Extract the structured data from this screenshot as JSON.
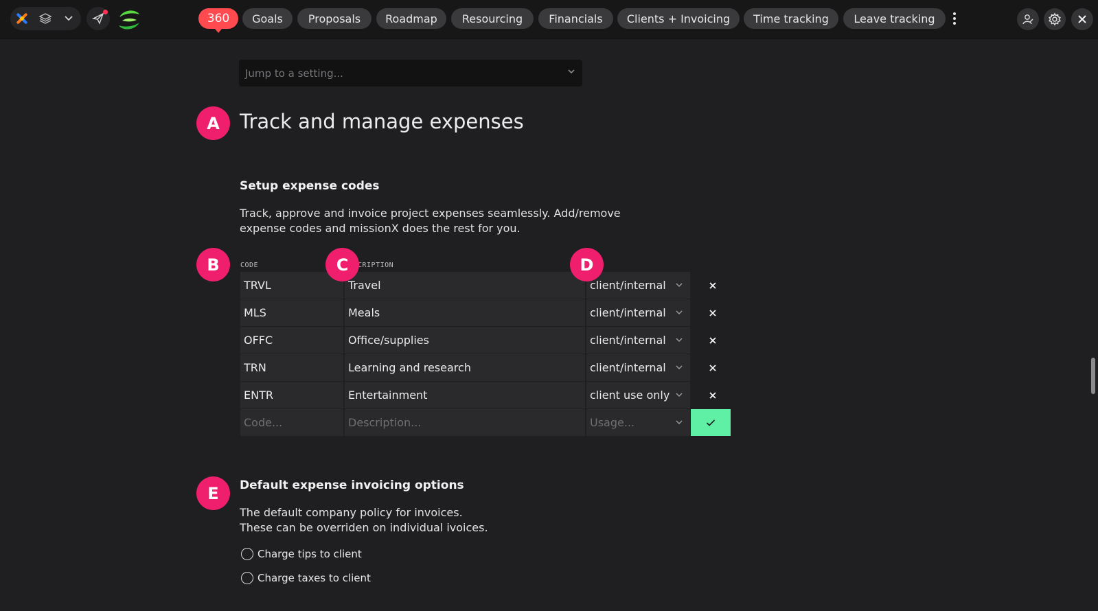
{
  "nav": {
    "tabs": [
      {
        "label": "360"
      },
      {
        "label": "Goals"
      },
      {
        "label": "Proposals"
      },
      {
        "label": "Roadmap"
      },
      {
        "label": "Resourcing"
      },
      {
        "label": "Financials"
      },
      {
        "label": "Clients + Invoicing"
      },
      {
        "label": "Time tracking"
      },
      {
        "label": "Leave tracking"
      }
    ],
    "active_tab": "360"
  },
  "jump": {
    "placeholder": "Jump to a setting..."
  },
  "markers": {
    "a": "A",
    "b": "B",
    "c": "C",
    "d": "D",
    "e": "E"
  },
  "section": {
    "title": "Track and manage expenses"
  },
  "expense_codes": {
    "heading": "Setup expense codes",
    "description_line1": "Track, approve and invoice project expenses seamlessly. Add/remove",
    "description_line2": "expense codes and missionX does the rest for you.",
    "col_code": "CODE",
    "col_desc": "CRIPTION",
    "rows": [
      {
        "code": "TRVL",
        "description": "Travel",
        "usage": "client/internal"
      },
      {
        "code": "MLS",
        "description": "Meals",
        "usage": "client/internal"
      },
      {
        "code": "OFFC",
        "description": "Office/supplies",
        "usage": "client/internal"
      },
      {
        "code": "TRN",
        "description": "Learning and research",
        "usage": "client/internal"
      },
      {
        "code": "ENTR",
        "description": "Entertainment",
        "usage": "client use only"
      }
    ],
    "new_row": {
      "code_placeholder": "Code...",
      "desc_placeholder": "Description...",
      "usage_placeholder": "Usage..."
    }
  },
  "invoicing": {
    "heading": "Default expense invoicing options",
    "line1": "The default company policy for invoices.",
    "line2": "These can be overriden on individual ivoices.",
    "options": [
      {
        "label": "Charge tips to client",
        "checked": false
      },
      {
        "label": "Charge taxes to client",
        "checked": false
      }
    ]
  },
  "colors": {
    "accent": "#ef1f6d",
    "confirm": "#5ff0a6",
    "active_tab": "#ff4a50"
  }
}
